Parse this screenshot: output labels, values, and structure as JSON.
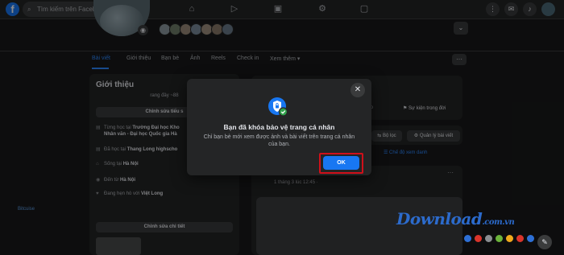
{
  "topbar": {
    "logo": "f",
    "search_placeholder": "Tìm kiếm trên Facebook",
    "nav_icons": [
      "home-icon",
      "watch-icon",
      "marketplace-icon",
      "groups-icon",
      "gaming-icon"
    ],
    "right_icons": [
      "menu-grid-icon",
      "messenger-icon",
      "notifications-icon",
      "account-icon"
    ]
  },
  "profile": {
    "chevron": "⌄"
  },
  "tabs": {
    "items": [
      "Bài viết",
      "Giới thiệu",
      "Bạn bè",
      "Ảnh",
      "Reels",
      "Check in",
      "Xem thêm ▾"
    ],
    "more": "···"
  },
  "intro": {
    "title": "Giới thiệu",
    "bio": "rang đây ~88",
    "edit_bio": "Chỉnh sửa tiểu s",
    "rows": [
      {
        "pre": "Từng học tại ",
        "bold": "Trường Đại học Kho",
        "icon": "school-icon"
      },
      {
        "pre": "",
        "bold": "Nhân văn - Đại học Quốc gia Hà",
        "icon": ""
      },
      {
        "pre": "Đã học tại ",
        "bold": "Thang Long highscho",
        "icon": "school-icon"
      },
      {
        "pre": "Sống tại ",
        "bold": "Hà Nội",
        "icon": "home-icon"
      },
      {
        "pre": "Đến từ ",
        "bold": "Hà Nội",
        "icon": "location-icon"
      },
      {
        "pre": "Đang hẹn hò với ",
        "bold": "Việt Long",
        "icon": "heart-icon"
      }
    ],
    "hobby": "Bitcuise",
    "edit_details": "Chỉnh sửa chi tiết"
  },
  "right": {
    "filter_bar": "Bộ lọc",
    "manage_posts": "Quản lý bài viết",
    "list_view": "Chế độ xem danh",
    "life_event": "Sự kiện trong đời",
    "reel_label": "ieo",
    "post_meta": "1 tháng 3 lúc 12:45 ·"
  },
  "modal": {
    "title": "Bạn đã khóa bảo vệ trang cá nhân",
    "body": "Chỉ bạn bè mới xem được ảnh và bài viết trên trang cá nhân của bạn.",
    "ok": "OK",
    "close": "✕",
    "accent": "#1877f2",
    "highlight": "#d0101a"
  },
  "watermark": {
    "text": "Download",
    "suffix": ".com.vn",
    "dots": [
      "#2d6fd6",
      "#d9342b",
      "#8a8d91",
      "#6bb33b",
      "#f0a91c",
      "#d9342b",
      "#2d6fd6"
    ]
  }
}
